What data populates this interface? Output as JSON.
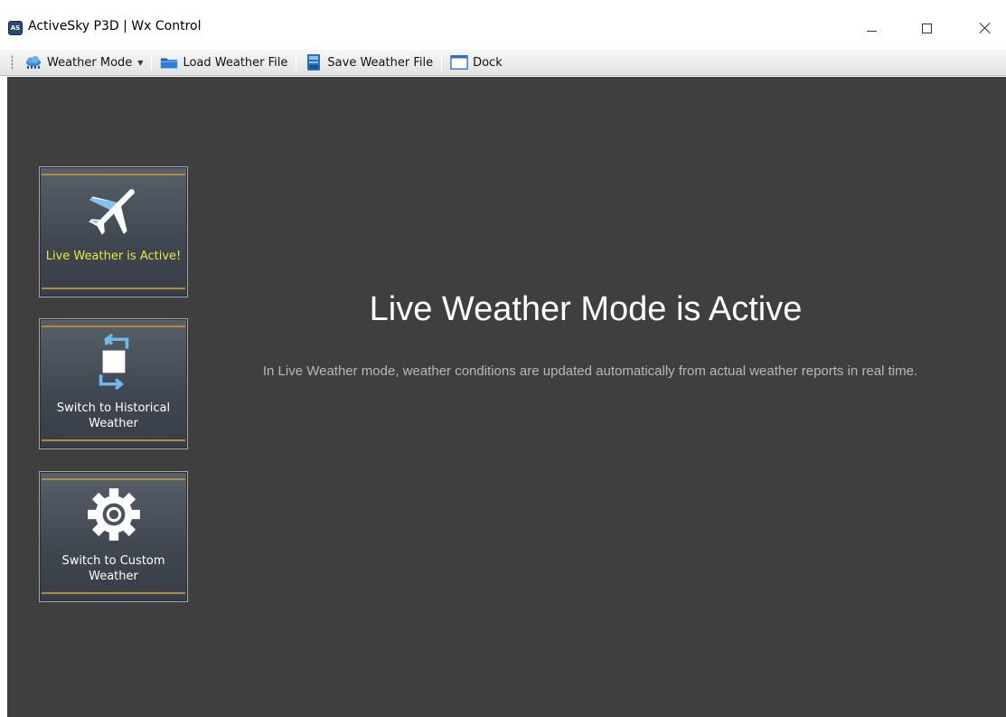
{
  "window": {
    "app_icon_text": "AS",
    "title": "ActiveSky P3D | Wx Control"
  },
  "toolbar": {
    "weather_mode_label": "Weather Mode",
    "load_label": "Load Weather File",
    "save_label": "Save Weather File",
    "dock_label": "Dock"
  },
  "modes": [
    {
      "label": "Live Weather is Active!",
      "icon": "airplane-icon",
      "active": true
    },
    {
      "label": "Switch to Historical Weather",
      "icon": "historical-icon",
      "active": false
    },
    {
      "label": "Switch to Custom Weather",
      "icon": "gear-icon",
      "active": false
    }
  ],
  "main": {
    "heading": "Live Weather Mode is Active",
    "description": "In Live Weather mode, weather conditions are updated automatically from actual weather reports in real time."
  },
  "colors": {
    "content_bg": "#3f3f3f",
    "active_label": "#e8ec3a",
    "tile_band": "#b58a3c",
    "description_text": "#b8b8b8"
  }
}
